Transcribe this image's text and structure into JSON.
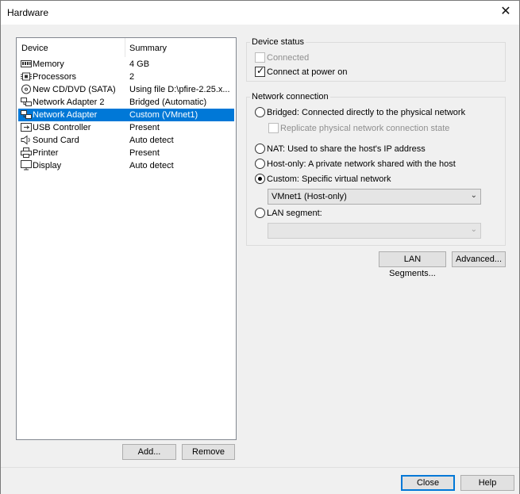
{
  "window": {
    "title": "Hardware"
  },
  "device_list": {
    "columns": {
      "device": "Device",
      "summary": "Summary"
    },
    "rows": [
      {
        "icon": "memory-icon",
        "name": "Memory",
        "summary": "4 GB"
      },
      {
        "icon": "processor-icon",
        "name": "Processors",
        "summary": "2"
      },
      {
        "icon": "cd-dvd-icon",
        "name": "New CD/DVD (SATA)",
        "summary": "Using file D:\\pfire-2.25.x..."
      },
      {
        "icon": "network-adapter-icon",
        "name": "Network Adapter 2",
        "summary": "Bridged (Automatic)"
      },
      {
        "icon": "network-adapter-icon",
        "name": "Network Adapter",
        "summary": "Custom (VMnet1)"
      },
      {
        "icon": "usb-icon",
        "name": "USB Controller",
        "summary": "Present"
      },
      {
        "icon": "sound-icon",
        "name": "Sound Card",
        "summary": "Auto detect"
      },
      {
        "icon": "printer-icon",
        "name": "Printer",
        "summary": "Present"
      },
      {
        "icon": "display-icon",
        "name": "Display",
        "summary": "Auto detect"
      }
    ],
    "selected_index": 4
  },
  "buttons": {
    "add": "Add...",
    "remove": "Remove",
    "lan_segments": "LAN Segments...",
    "advanced": "Advanced...",
    "close": "Close",
    "help": "Help"
  },
  "device_status": {
    "label": "Device status",
    "connected": {
      "label": "Connected",
      "checked": false,
      "enabled": false
    },
    "connect_at_power_on": {
      "label": "Connect at power on",
      "checked": true,
      "enabled": true
    }
  },
  "network_connection": {
    "label": "Network connection",
    "bridged": "Bridged: Connected directly to the physical network",
    "replicate": "Replicate physical network connection state",
    "nat": "NAT: Used to share the host's IP address",
    "host_only": "Host-only: A private network shared with the host",
    "custom": "Custom: Specific virtual network",
    "custom_value": "VMnet1 (Host-only)",
    "lan_segment": "LAN segment:",
    "lan_segment_value": "",
    "selected": "custom"
  }
}
